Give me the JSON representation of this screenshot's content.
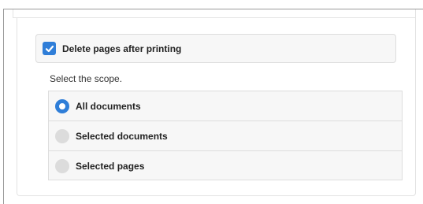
{
  "print_options": {
    "delete_pages": {
      "label": "Delete pages after printing",
      "checked": true,
      "icon": "checkmark-icon"
    },
    "scope": {
      "label": "Select the scope.",
      "options": [
        {
          "label": "All documents",
          "selected": true
        },
        {
          "label": "Selected documents",
          "selected": false
        },
        {
          "label": "Selected pages",
          "selected": false
        }
      ]
    }
  },
  "colors": {
    "accent": "#2f7ed8",
    "panel_bg": "#f7f7f7",
    "border": "#dddddd",
    "radio_unselected": "#dcdcdc"
  }
}
